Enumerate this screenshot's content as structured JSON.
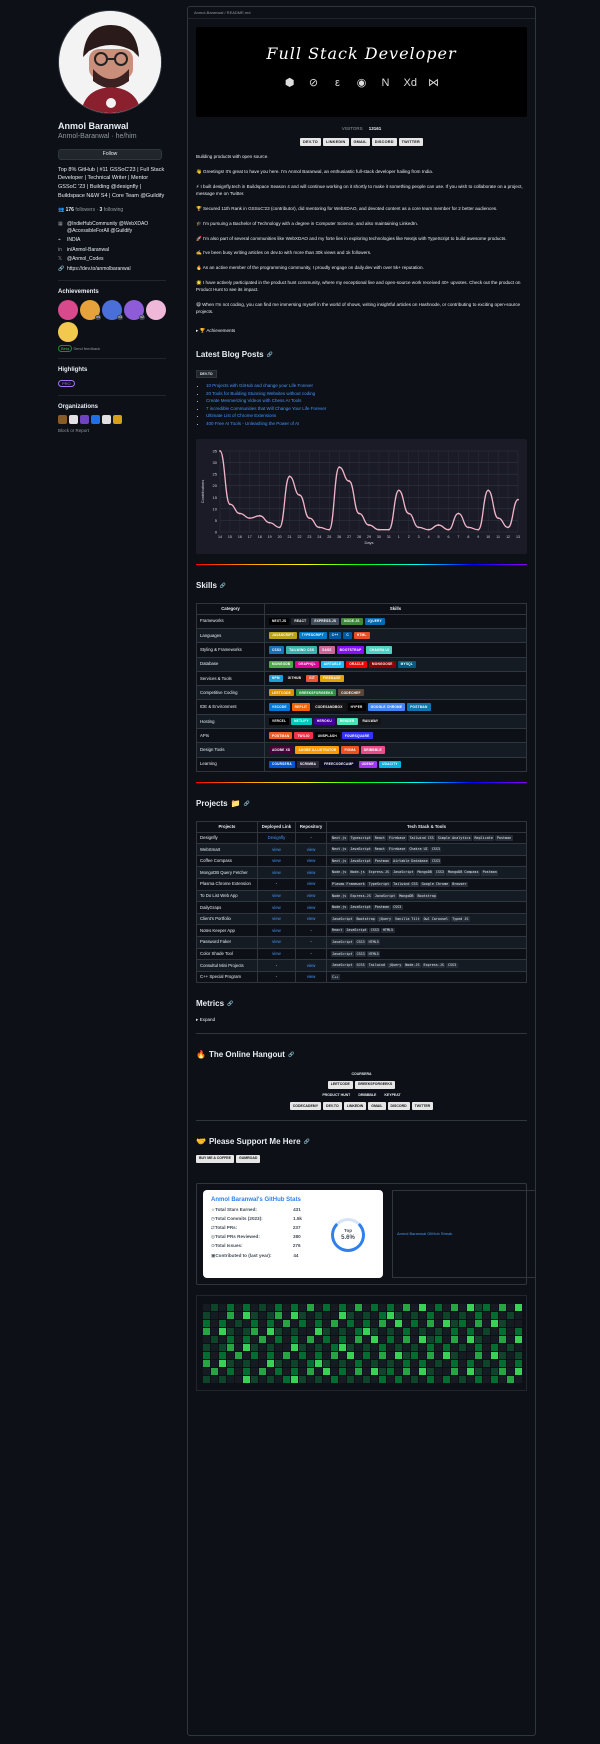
{
  "profile": {
    "name": "Anmol Baranwal",
    "handle": "Anmol-Baranwal · he/him",
    "follow_label": "Follow",
    "bio": "Top 8% GitHub | #11 GSSoC'23 | Full Stack Developer | Technical Writer | Mentor GSSoC '23 | Building @designfly | Buildspace N&W S4 | Core Team @Guildify",
    "followers": "176",
    "followers_label": "followers ·",
    "following": "3",
    "following_label": "following",
    "info": [
      {
        "icon": "people-icon",
        "text": "@IndieHubCommunity @WebXDAO @AccessibleForAll @Guildify"
      },
      {
        "icon": "location-icon",
        "text": "INDIA"
      },
      {
        "icon": "mail-icon",
        "text": "in/Anmol-Baranwal"
      },
      {
        "icon": "x-icon",
        "text": "@Anmol_Codes"
      },
      {
        "icon": "link-icon",
        "text": "https://dev.to/anmolbaranwal"
      }
    ],
    "achievements_title": "Achievements",
    "achievements": [
      {
        "color": "#d94a8c",
        "count": ""
      },
      {
        "color": "#e6a23c",
        "count": "x4"
      },
      {
        "color": "#4a6fd9",
        "count": "x3"
      },
      {
        "color": "#8e5cd9",
        "count": "x2"
      },
      {
        "color": "#f0b8d8",
        "count": ""
      },
      {
        "color": "#f2c94c",
        "count": ""
      }
    ],
    "beta_tag": "Beta",
    "beta_text": "Send feedback",
    "highlights_title": "Highlights",
    "pro_label": "PRO",
    "organizations_title": "Organizations",
    "orgs": [
      "#8a5a2b",
      "#e2e2e2",
      "#6f42c1",
      "#1f6feb",
      "#e0e0e0",
      "#d4a017"
    ],
    "block_label": "Block or Report"
  },
  "readme": {
    "path": "Anmol-Baranwal / README.md",
    "banner_title": "Full Stack Developer",
    "banner_icons": [
      "⬢",
      "⊘",
      "ε",
      "◉",
      "N",
      "Xd",
      "⋈"
    ],
    "visitors_label": "VISITORS",
    "visitors_count": "13161",
    "social_badges": [
      "DEV.TO",
      "LINKEDIN",
      "GMAIL",
      "DISCORD",
      "TWITTER"
    ],
    "tagline": "Building products with open source.",
    "paragraphs": [
      "👋 Greetings! It's great to have you here. I'm Anmol Baranwal, an enthusiastic full-stack developer hailing from India.",
      "⚡ I built designfly.tech in Buildspace Season 4 and will continue working on it shortly to make it something people can use. If you wish to collaborate on a project, message me on Twitter.",
      "🏆 Secured 11th Rank in GSSoC'23 (contributor), did mentoring for WebXDAO, and devoted content as a core team member for 2 better audiences.",
      "🎓 I'm pursuing a Bachelor of Technology with a degree in Computer Science, and also maintaining LinkedIn.",
      "🚀 I'm also part of several communities like WebXDAO and my forte lies in exploring technologies like Nextjs with TypeScript to build awesome products.",
      "✍️ I've been busy writing articles on dev.to with more than 30k views and 1k followers.",
      "🔥 As an active member of the programming community, I proudly engage on daily.dev with over 5k+ reputation.",
      "🌟 I have actively participated in the product hunt community, where my exceptional live and open-source work received 40+ upvotes. Check out the product on Product Hunt to see its impact.",
      "😄 When I'm not coding, you can find me immersing myself in the world of shows, writing insightful articles on Hashnode, or contributing to exciting open-source projects."
    ],
    "achievements_details": "▸ 🏆 Achievements",
    "blog_title": "Latest Blog Posts",
    "blog_badge": "DEV.TO",
    "blog_posts": [
      "10 Projects with GitHub and change your Life Forever",
      "20 Tools for Building Stunning Websites without coding",
      "Create Mesmerizing Videos with Chess AI Tools",
      "7 incredible Communities that Will Change Your Life Forever",
      "Ultimate List of Chrome Extensions",
      "400 Free AI Tools - Unleashing the Power of AI"
    ],
    "skills_title": "Skills",
    "projects_title": "Projects",
    "metrics_title": "Metrics",
    "metrics_expand": "▸ Expand",
    "hangout_title": "The Online Hangout",
    "hangout_rows": [
      [
        "COURSERA"
      ],
      [
        "LEETCODE",
        "GREEKSFORGEEKS"
      ],
      [
        "PRODUCT HUNT",
        "DRIBBBLE",
        "KEYPEAT"
      ],
      [
        "CODECADEMY",
        "DEV.TO",
        "LINKEDIN",
        "GMAIL",
        "DISCORD",
        "TWITTER"
      ]
    ],
    "support_title": "Please Support Me Here",
    "support_badges": [
      "BUY ME A COFFEE",
      "GUMROAD"
    ],
    "stats_alt": "Anmol Baranwal GitHub Streak"
  },
  "chart_data": {
    "type": "line",
    "title": "",
    "xlabel": "Days",
    "ylabel": "Contributions",
    "x": [
      "14",
      "15",
      "16",
      "17",
      "18",
      "19",
      "20",
      "21",
      "22",
      "23",
      "24",
      "25",
      "26",
      "27",
      "28",
      "29",
      "30",
      "31",
      "1",
      "2",
      "3",
      "4",
      "5",
      "6",
      "7",
      "8",
      "9",
      "10",
      "11",
      "12",
      "13"
    ],
    "values": [
      35,
      12,
      8,
      6,
      7,
      4,
      2,
      24,
      16,
      6,
      2,
      1,
      28,
      22,
      8,
      3,
      1,
      1,
      18,
      8,
      2,
      1,
      3,
      1,
      8,
      2,
      1,
      18,
      6,
      2,
      14
    ],
    "ylim": [
      0,
      35
    ],
    "yticks": [
      0,
      5,
      10,
      15,
      20,
      25,
      30,
      35
    ],
    "grid": true,
    "line_color": "#f1b4c8",
    "background": "#1a1b27"
  },
  "skills": {
    "header_category": "Category",
    "header_skills": "Skills",
    "rows": [
      {
        "cat": "Frameworks",
        "items": [
          {
            "t": "NEXT.JS",
            "c": "#000000"
          },
          {
            "t": "REACT",
            "c": "#20232a"
          },
          {
            "t": "EXPRESS.JS",
            "c": "#404d59"
          },
          {
            "t": "NODE.JS",
            "c": "#43853d"
          },
          {
            "t": "JQUERY",
            "c": "#0769ad"
          }
        ]
      },
      {
        "cat": "Languages",
        "items": [
          {
            "t": "JAVASCRIPT",
            "c": "#b8a51e"
          },
          {
            "t": "TYPESCRIPT",
            "c": "#007acc"
          },
          {
            "t": "C++",
            "c": "#00599c"
          },
          {
            "t": "C",
            "c": "#00599c"
          },
          {
            "t": "HTML",
            "c": "#e34f26"
          }
        ]
      },
      {
        "cat": "Styling & Frameworks",
        "items": [
          {
            "t": "CSS3",
            "c": "#1572b6"
          },
          {
            "t": "TAILWIND CSS",
            "c": "#38b2ac"
          },
          {
            "t": "SASS",
            "c": "#cc6699"
          },
          {
            "t": "BOOTSTRAP",
            "c": "#8511fa"
          },
          {
            "t": "CHAKRA UI",
            "c": "#4ed1c5"
          }
        ]
      },
      {
        "cat": "Database",
        "items": [
          {
            "t": "MONGODB",
            "c": "#4ea94b"
          },
          {
            "t": "GRAPHQL",
            "c": "#e10098"
          },
          {
            "t": "AIRTABLE",
            "c": "#18bfff"
          },
          {
            "t": "ORACLE",
            "c": "#f80000"
          },
          {
            "t": "MONGOOSE",
            "c": "#880000"
          },
          {
            "t": "MYSQL",
            "c": "#005c84"
          }
        ]
      },
      {
        "cat": "Services & Tools",
        "items": [
          {
            "t": "NPM",
            "c": "#1ba0d7"
          },
          {
            "t": "GITHUB",
            "c": "#121011"
          },
          {
            "t": "GIT",
            "c": "#f05033"
          },
          {
            "t": "FIREBASE",
            "c": "#e3a10a"
          }
        ]
      },
      {
        "cat": "Competitive Coding",
        "items": [
          {
            "t": "LEETCODE",
            "c": "#d89000"
          },
          {
            "t": "GREEKSFORGEEKS",
            "c": "#2f8d46"
          },
          {
            "t": "CODECHEF",
            "c": "#5b4638"
          }
        ]
      },
      {
        "cat": "IDE & Environment",
        "items": [
          {
            "t": "VSCODE",
            "c": "#0078d7"
          },
          {
            "t": "REPLIT",
            "c": "#f26207"
          },
          {
            "t": "CODESANDBOX",
            "c": "#151515"
          },
          {
            "t": "HYPER",
            "c": "#000000"
          },
          {
            "t": "GOOGLE CHROME",
            "c": "#4285f4"
          },
          {
            "t": "POSTMAN",
            "c": "#0e76a8"
          }
        ]
      },
      {
        "cat": "Hosting",
        "items": [
          {
            "t": "VERCEL",
            "c": "#000000"
          },
          {
            "t": "NETLIFY",
            "c": "#00c7b7"
          },
          {
            "t": "HEROKU",
            "c": "#430098"
          },
          {
            "t": "RENDER",
            "c": "#46e3b7"
          },
          {
            "t": "RAILWAY",
            "c": "#131415"
          }
        ]
      },
      {
        "cat": "APIs",
        "items": [
          {
            "t": "POSTMAN",
            "c": "#ef5b25"
          },
          {
            "t": "TWILIO",
            "c": "#f22f46"
          },
          {
            "t": "UNSPLASH",
            "c": "#000000"
          },
          {
            "t": "FOURSQUARE",
            "c": "#3333ff"
          }
        ]
      },
      {
        "cat": "Design Tools",
        "items": [
          {
            "t": "ADOBE XD",
            "c": "#470137"
          },
          {
            "t": "ADOBE ILLUSTRATOR",
            "c": "#ff9a00"
          },
          {
            "t": "FIGMA",
            "c": "#f24e1e"
          },
          {
            "t": "DRIBBBLE",
            "c": "#ea4c89"
          }
        ]
      },
      {
        "cat": "Learning",
        "items": [
          {
            "t": "COURSERA",
            "c": "#0056d2"
          },
          {
            "t": "SCRIMBA",
            "c": "#2b283a"
          },
          {
            "t": "FREECODECAMP",
            "c": "#0a0a23"
          },
          {
            "t": "UDEMY",
            "c": "#a435f0"
          },
          {
            "t": "UDACITY",
            "c": "#02b3e4"
          }
        ]
      }
    ]
  },
  "projects": {
    "headers": [
      "Projects",
      "Deployed Link",
      "Repository",
      "Tech Stack & Tools"
    ],
    "rows": [
      {
        "name": "Designfly",
        "link": "Designfly",
        "repo": "-",
        "tech": [
          "Next.js",
          "Typescript",
          "React",
          "Firebase",
          "Tailwind CSS",
          "Simple Analytics",
          "Replicate",
          "Postman"
        ]
      },
      {
        "name": "WebSmart",
        "link": "view",
        "repo": "view",
        "tech": [
          "Next.js",
          "JavaScript",
          "React",
          "Firebase",
          "Chakra UI",
          "CSS3"
        ]
      },
      {
        "name": "Coffee Compass",
        "link": "view",
        "repo": "view",
        "tech": [
          "Next.js",
          "JavaScript",
          "Postman",
          "Airtable Database",
          "CSS3"
        ]
      },
      {
        "name": "MongoDB Query Fetcher",
        "link": "view",
        "repo": "view",
        "tech": [
          "Node.js",
          "Node.js",
          "Express.JS",
          "JavaScript",
          "MongoDB",
          "CSS3",
          "MongoDB Compass",
          "Postman"
        ]
      },
      {
        "name": "Plasma Chrome Extension",
        "link": "-",
        "repo": "view",
        "tech": [
          "Plasmo Framework",
          "TypeScript",
          "Tailwind CSS",
          "Google Chrome",
          "Browser"
        ]
      },
      {
        "name": "To Do List Web App",
        "link": "view",
        "repo": "view",
        "tech": [
          "Node.js",
          "Express.JS",
          "JavaScript",
          "MongoDB",
          "Bootstrap"
        ]
      },
      {
        "name": "DailyGraps",
        "link": "view",
        "repo": "view",
        "tech": [
          "Node.js",
          "JavaScript",
          "Postman",
          "CSS3"
        ]
      },
      {
        "name": "Client's Portfolio",
        "link": "view",
        "repo": "view",
        "tech": [
          "JavaScript",
          "Bootstrap",
          "jQuery",
          "Vanilla Tilt",
          "Owl Carousel",
          "Typed JS"
        ]
      },
      {
        "name": "Notes Keeper App",
        "link": "view",
        "repo": "-",
        "tech": [
          "React",
          "JavaScript",
          "CSS3",
          "HTML5"
        ]
      },
      {
        "name": "Password Faker",
        "link": "view",
        "repo": "-",
        "tech": [
          "JavaScript",
          "CSS3",
          "HTML5"
        ]
      },
      {
        "name": "Color Shade Tool",
        "link": "view",
        "repo": "-",
        "tech": [
          "JavaScript",
          "CSS3",
          "HTML5"
        ]
      },
      {
        "name": "Consultul Mini Projects",
        "link": "-",
        "repo": "view",
        "tech": [
          "JavaScript",
          "SCSS",
          "Tailwind",
          "jQuery",
          "Node.JS",
          "Express.JS",
          "CSS3"
        ]
      },
      {
        "name": "C++ Special Program",
        "link": "-",
        "repo": "view",
        "tech": [
          "C++"
        ]
      }
    ]
  },
  "stats": {
    "title": "Anmol Baranwal's GitHub Stats",
    "rows": [
      {
        "label": "Total Stars Earned:",
        "value": "431"
      },
      {
        "label": "Total Commits (2023):",
        "value": "1.5k"
      },
      {
        "label": "Total PRs:",
        "value": "237"
      },
      {
        "label": "Total PRs Reviewed:",
        "value": "380"
      },
      {
        "label": "Total Issues:",
        "value": "276"
      },
      {
        "label": "Contributed to (last year):",
        "value": "44"
      }
    ],
    "rank_label": "Top",
    "rank_value": "5.6%"
  }
}
